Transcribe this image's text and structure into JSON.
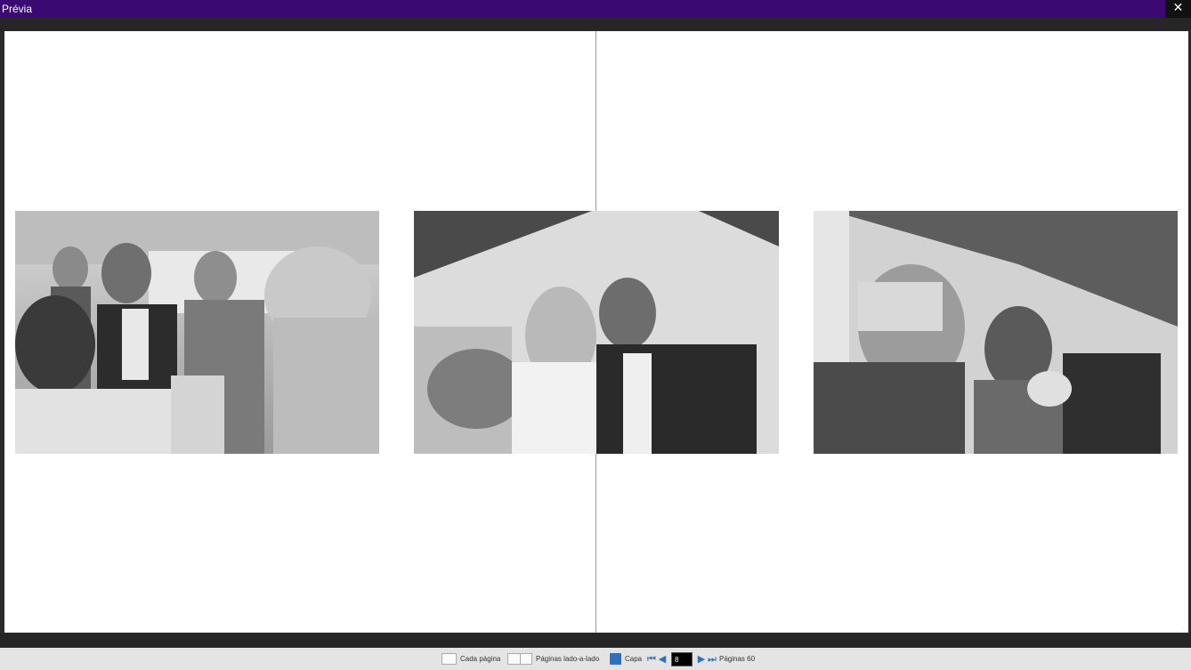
{
  "window": {
    "title": "Prévia",
    "close_icon": "close-icon"
  },
  "photos": [
    {
      "name": "photo-ceremony-officiant",
      "description_icon": "photo"
    },
    {
      "name": "photo-couple-kiss",
      "description_icon": "photo"
    },
    {
      "name": "photo-guests-hug",
      "description_icon": "photo"
    }
  ],
  "toolbar": {
    "single_page_label": "Cada página",
    "side_by_side_label": "Páginas lado-a-lado",
    "cover_label": "Capa",
    "current_page": "8",
    "pages_label": "Páginas 60"
  },
  "colors": {
    "titlebar": "#3a0a72",
    "accent": "#2d6fc0"
  }
}
